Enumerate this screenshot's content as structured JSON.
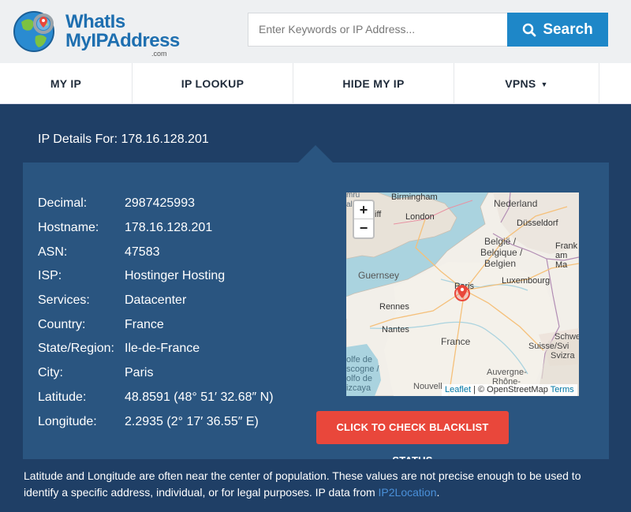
{
  "header": {
    "logo_line1": "WhatIs",
    "logo_line2": "MyIPAddress",
    "logo_suffix": ".com",
    "search_placeholder": "Enter Keywords or IP Address...",
    "search_button": "Search"
  },
  "nav": {
    "items": [
      {
        "label": "MY IP"
      },
      {
        "label": "IP LOOKUP"
      },
      {
        "label": "HIDE MY IP"
      },
      {
        "label": "VPNS"
      }
    ]
  },
  "details": {
    "heading": "IP Details For: 178.16.128.201",
    "rows": [
      {
        "key": "Decimal:",
        "value": "2987425993"
      },
      {
        "key": "Hostname:",
        "value": "178.16.128.201"
      },
      {
        "key": "ASN:",
        "value": "47583"
      },
      {
        "key": "ISP:",
        "value": "Hostinger Hosting"
      },
      {
        "key": "Services:",
        "value": "Datacenter"
      },
      {
        "key": "Country:",
        "value": "France"
      },
      {
        "key": "State/Region:",
        "value": "Ile-de-France"
      },
      {
        "key": "City:",
        "value": "Paris"
      },
      {
        "key": "Latitude:",
        "value": "48.8591 (48° 51′ 32.68″ N)"
      },
      {
        "key": "Longitude:",
        "value": "2.2935 (2° 17′ 36.55″ E)"
      }
    ]
  },
  "map": {
    "zoom_in": "+",
    "zoom_out": "−",
    "attribution_leaflet": "Leaflet",
    "attribution_sep": "| © OpenStreetMap",
    "attribution_terms": "Terms",
    "labels": {
      "birmingham": "Birmingham",
      "london": "London",
      "nederland": "Nederland",
      "dusseldorf": "Düsseldorf",
      "belgique1": "België /",
      "belgique2": "Belgique /",
      "belgique3": "Belgien",
      "frank1": "Frank",
      "frank2": "am Ma",
      "guernsey": "Guernsey",
      "paris": "Paris",
      "luxembourg": "Luxembourg",
      "rennes": "Rennes",
      "nantes": "Nantes",
      "france": "France",
      "schweiz1": "Schwe",
      "schweiz2": "Suisse/Svi",
      "schweiz3": "Svizra",
      "golfe1": "olfe de",
      "golfe2": "scogne /",
      "golfe3": "olfo de",
      "golfe4": "izcaya",
      "auvergne1": "Auvergne-",
      "auvergne2": "Rhône-",
      "nouvell": "Nouvell",
      "cymru": "mru",
      "ales": "ales",
      "iff": "iff"
    }
  },
  "blacklist_button": "CLICK TO CHECK BLACKLIST STATUS",
  "note": {
    "text": "Latitude and Longitude are often near the center of population. These values are not precise enough to be used to identify a specific address, individual, or for legal purposes. IP data from ",
    "link": "IP2Location",
    "end": "."
  },
  "colors": {
    "header_bg": "#eef0f2",
    "brand_blue": "#1e87c8",
    "page_bg": "#1f3f66",
    "panel_bg": "#2a5580",
    "accent_red": "#e9473b"
  },
  "icons": {
    "logo": "globe-magnifier-icon",
    "search": "search-icon",
    "nav_dropdown": "caret-down-icon",
    "marker": "map-marker-icon"
  }
}
